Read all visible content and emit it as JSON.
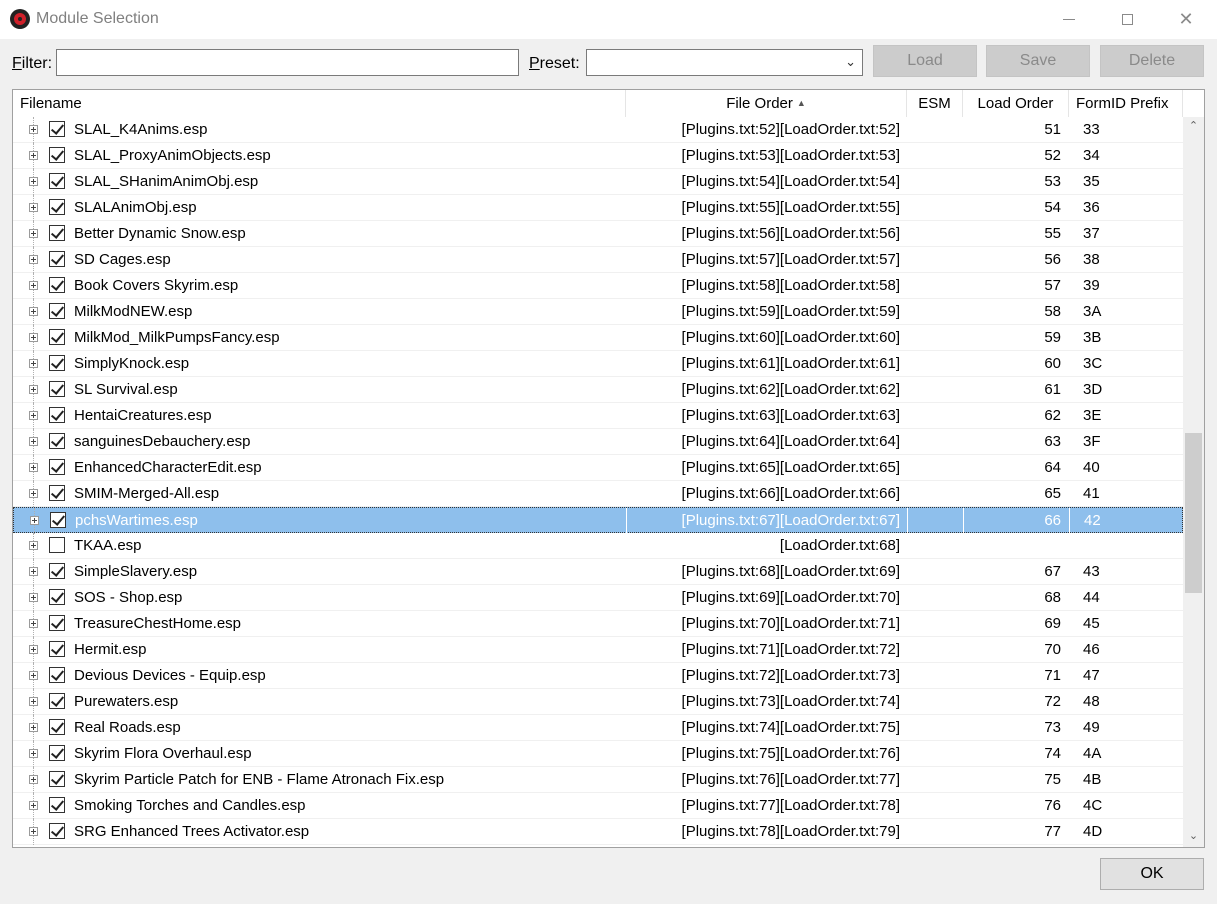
{
  "window": {
    "title": "Module Selection",
    "icon": "app-icon-red-circle"
  },
  "toolbar": {
    "filter_label_accel": "F",
    "filter_label_rest": "ilter:",
    "filter_value": "",
    "preset_label_accel": "P",
    "preset_label_rest": "reset:",
    "preset_value": "",
    "load_label": "Load",
    "save_label": "Save",
    "delete_label": "Delete"
  },
  "grid": {
    "columns": {
      "filename": "Filename",
      "file_order": "File Order",
      "esm": "ESM",
      "load_order": "Load Order",
      "formid_prefix": "FormID Prefix"
    },
    "sort_indicator": "▲",
    "rows": [
      {
        "name": "SLAL_K4Anims.esp",
        "checked": true,
        "order": "[Plugins.txt:52][LoadOrder.txt:52]",
        "esm": "",
        "load": "51",
        "prefix": "33"
      },
      {
        "name": "SLAL_ProxyAnimObjects.esp",
        "checked": true,
        "order": "[Plugins.txt:53][LoadOrder.txt:53]",
        "esm": "",
        "load": "52",
        "prefix": "34"
      },
      {
        "name": "SLAL_SHanimAnimObj.esp",
        "checked": true,
        "order": "[Plugins.txt:54][LoadOrder.txt:54]",
        "esm": "",
        "load": "53",
        "prefix": "35"
      },
      {
        "name": "SLALAnimObj.esp",
        "checked": true,
        "order": "[Plugins.txt:55][LoadOrder.txt:55]",
        "esm": "",
        "load": "54",
        "prefix": "36"
      },
      {
        "name": "Better Dynamic Snow.esp",
        "checked": true,
        "order": "[Plugins.txt:56][LoadOrder.txt:56]",
        "esm": "",
        "load": "55",
        "prefix": "37"
      },
      {
        "name": "SD Cages.esp",
        "checked": true,
        "order": "[Plugins.txt:57][LoadOrder.txt:57]",
        "esm": "",
        "load": "56",
        "prefix": "38"
      },
      {
        "name": "Book Covers Skyrim.esp",
        "checked": true,
        "order": "[Plugins.txt:58][LoadOrder.txt:58]",
        "esm": "",
        "load": "57",
        "prefix": "39"
      },
      {
        "name": "MilkModNEW.esp",
        "checked": true,
        "order": "[Plugins.txt:59][LoadOrder.txt:59]",
        "esm": "",
        "load": "58",
        "prefix": "3A"
      },
      {
        "name": "MilkMod_MilkPumpsFancy.esp",
        "checked": true,
        "order": "[Plugins.txt:60][LoadOrder.txt:60]",
        "esm": "",
        "load": "59",
        "prefix": "3B"
      },
      {
        "name": "SimplyKnock.esp",
        "checked": true,
        "order": "[Plugins.txt:61][LoadOrder.txt:61]",
        "esm": "",
        "load": "60",
        "prefix": "3C"
      },
      {
        "name": "SL Survival.esp",
        "checked": true,
        "order": "[Plugins.txt:62][LoadOrder.txt:62]",
        "esm": "",
        "load": "61",
        "prefix": "3D"
      },
      {
        "name": "HentaiCreatures.esp",
        "checked": true,
        "order": "[Plugins.txt:63][LoadOrder.txt:63]",
        "esm": "",
        "load": "62",
        "prefix": "3E"
      },
      {
        "name": "sanguinesDebauchery.esp",
        "checked": true,
        "order": "[Plugins.txt:64][LoadOrder.txt:64]",
        "esm": "",
        "load": "63",
        "prefix": "3F"
      },
      {
        "name": "EnhancedCharacterEdit.esp",
        "checked": true,
        "order": "[Plugins.txt:65][LoadOrder.txt:65]",
        "esm": "",
        "load": "64",
        "prefix": "40"
      },
      {
        "name": "SMIM-Merged-All.esp",
        "checked": true,
        "order": "[Plugins.txt:66][LoadOrder.txt:66]",
        "esm": "",
        "load": "65",
        "prefix": "41"
      },
      {
        "name": "pchsWartimes.esp",
        "checked": true,
        "order": "[Plugins.txt:67][LoadOrder.txt:67]",
        "esm": "",
        "load": "66",
        "prefix": "42",
        "selected": true
      },
      {
        "name": "TKAA.esp",
        "checked": false,
        "order": "[LoadOrder.txt:68]",
        "esm": "",
        "load": "",
        "prefix": ""
      },
      {
        "name": "SimpleSlavery.esp",
        "checked": true,
        "order": "[Plugins.txt:68][LoadOrder.txt:69]",
        "esm": "",
        "load": "67",
        "prefix": "43"
      },
      {
        "name": "SOS - Shop.esp",
        "checked": true,
        "order": "[Plugins.txt:69][LoadOrder.txt:70]",
        "esm": "",
        "load": "68",
        "prefix": "44"
      },
      {
        "name": "TreasureChestHome.esp",
        "checked": true,
        "order": "[Plugins.txt:70][LoadOrder.txt:71]",
        "esm": "",
        "load": "69",
        "prefix": "45"
      },
      {
        "name": "Hermit.esp",
        "checked": true,
        "order": "[Plugins.txt:71][LoadOrder.txt:72]",
        "esm": "",
        "load": "70",
        "prefix": "46"
      },
      {
        "name": "Devious Devices - Equip.esp",
        "checked": true,
        "order": "[Plugins.txt:72][LoadOrder.txt:73]",
        "esm": "",
        "load": "71",
        "prefix": "47"
      },
      {
        "name": "Purewaters.esp",
        "checked": true,
        "order": "[Plugins.txt:73][LoadOrder.txt:74]",
        "esm": "",
        "load": "72",
        "prefix": "48"
      },
      {
        "name": "Real Roads.esp",
        "checked": true,
        "order": "[Plugins.txt:74][LoadOrder.txt:75]",
        "esm": "",
        "load": "73",
        "prefix": "49"
      },
      {
        "name": "Skyrim Flora Overhaul.esp",
        "checked": true,
        "order": "[Plugins.txt:75][LoadOrder.txt:76]",
        "esm": "",
        "load": "74",
        "prefix": "4A"
      },
      {
        "name": "Skyrim Particle Patch for ENB - Flame Atronach Fix.esp",
        "checked": true,
        "order": "[Plugins.txt:76][LoadOrder.txt:77]",
        "esm": "",
        "load": "75",
        "prefix": "4B"
      },
      {
        "name": "Smoking Torches and Candles.esp",
        "checked": true,
        "order": "[Plugins.txt:77][LoadOrder.txt:78]",
        "esm": "",
        "load": "76",
        "prefix": "4C"
      },
      {
        "name": "SRG Enhanced Trees Activator.esp",
        "checked": true,
        "order": "[Plugins.txt:78][LoadOrder.txt:79]",
        "esm": "",
        "load": "77",
        "prefix": "4D"
      }
    ]
  },
  "footer": {
    "ok_label": "OK"
  },
  "colors": {
    "selection": "#8ebfec",
    "disabled_button": "#cccccc"
  }
}
